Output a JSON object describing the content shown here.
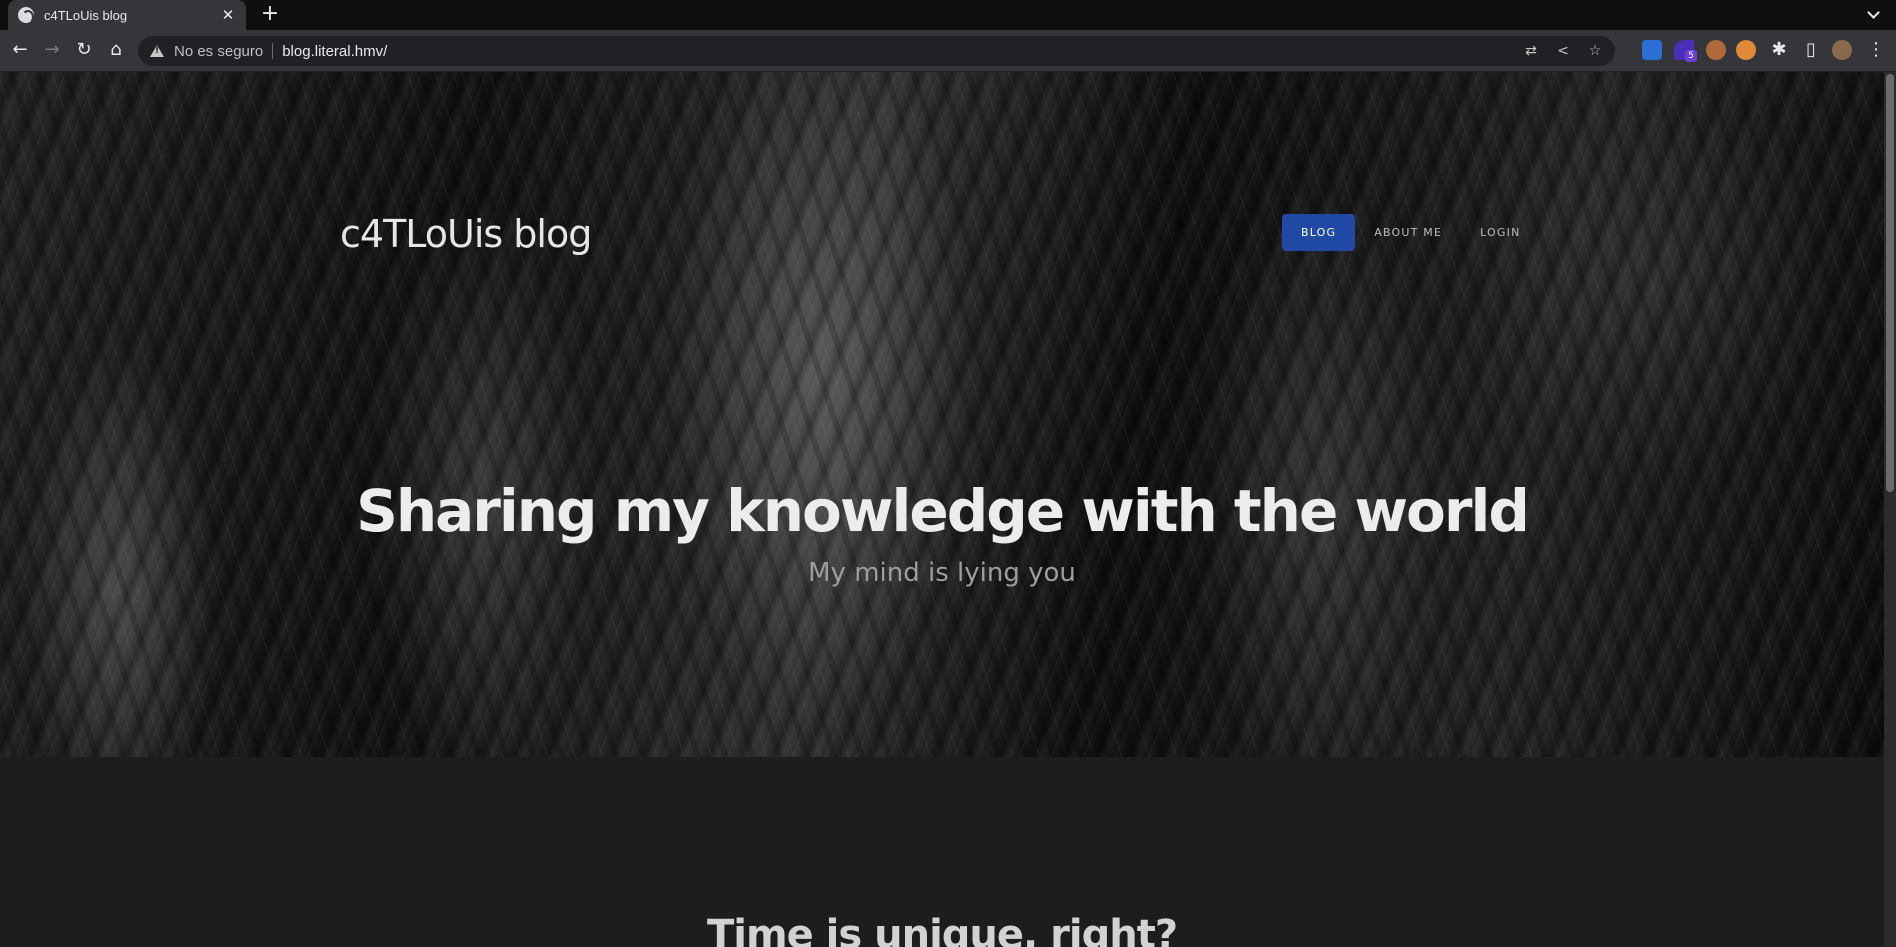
{
  "browser": {
    "tab_title": "c4TLoUis blog",
    "security_label": "No es seguro",
    "url": "blog.literal.hmv/",
    "extension_badge": "5"
  },
  "site": {
    "title": "c4TLoUis blog",
    "nav": [
      {
        "label": "BLOG",
        "active": true
      },
      {
        "label": "ABOUT ME",
        "active": false
      },
      {
        "label": "LOGIN",
        "active": false
      }
    ],
    "hero_heading": "Sharing my knowledge with the world",
    "hero_subheading": "My mind is lying you",
    "section_title": "Time is unique, right?"
  },
  "colors": {
    "active_nav": "#1f49a3",
    "page_bg": "#1c1d1f"
  }
}
